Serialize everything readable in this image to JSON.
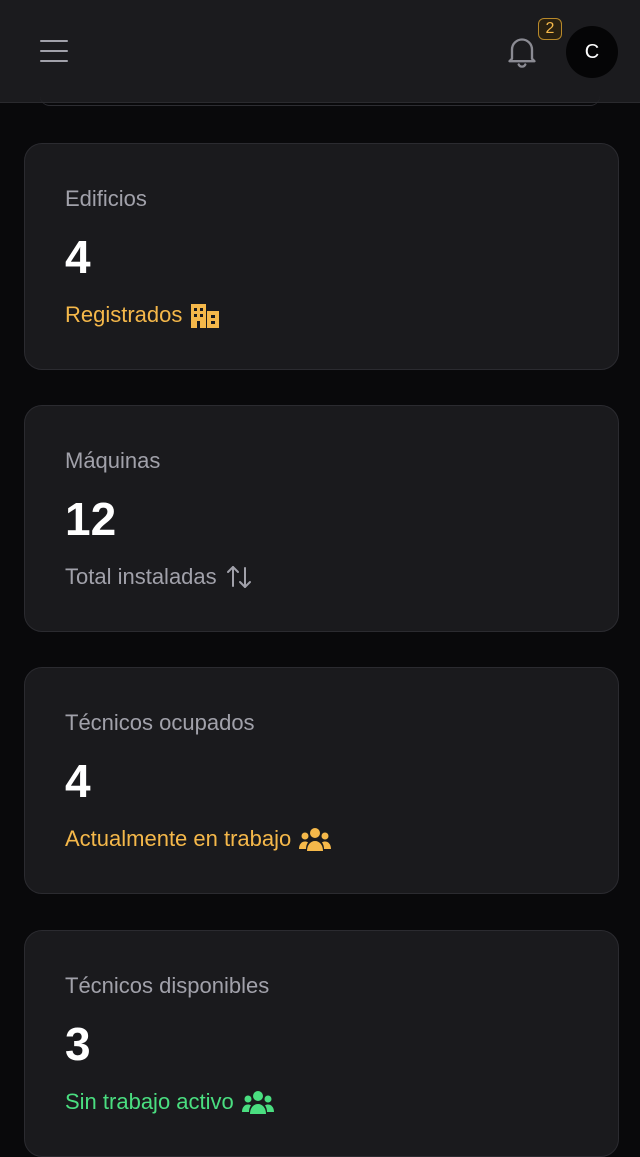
{
  "header": {
    "menu_icon": "hamburger-icon",
    "bell_icon": "bell-icon",
    "notification_count": "2",
    "avatar_initial": "C"
  },
  "colors": {
    "amber": "#f5b84a",
    "gray": "#a1a1aa",
    "green": "#4ade80"
  },
  "cards": [
    {
      "label": "Edificios",
      "value": "4",
      "sub": "Registrados",
      "icon": "building-icon",
      "sub_color": "#f5b84a"
    },
    {
      "label": "Máquinas",
      "value": "12",
      "sub": "Total instaladas",
      "icon": "arrows-up-down-icon",
      "sub_color": "#a1a1aa"
    },
    {
      "label": "Técnicos ocupados",
      "value": "4",
      "sub": "Actualmente en trabajo",
      "icon": "users-icon",
      "sub_color": "#f5b84a"
    },
    {
      "label": "Técnicos disponibles",
      "value": "3",
      "sub": "Sin trabajo activo",
      "icon": "users-icon",
      "sub_color": "#4ade80"
    }
  ]
}
